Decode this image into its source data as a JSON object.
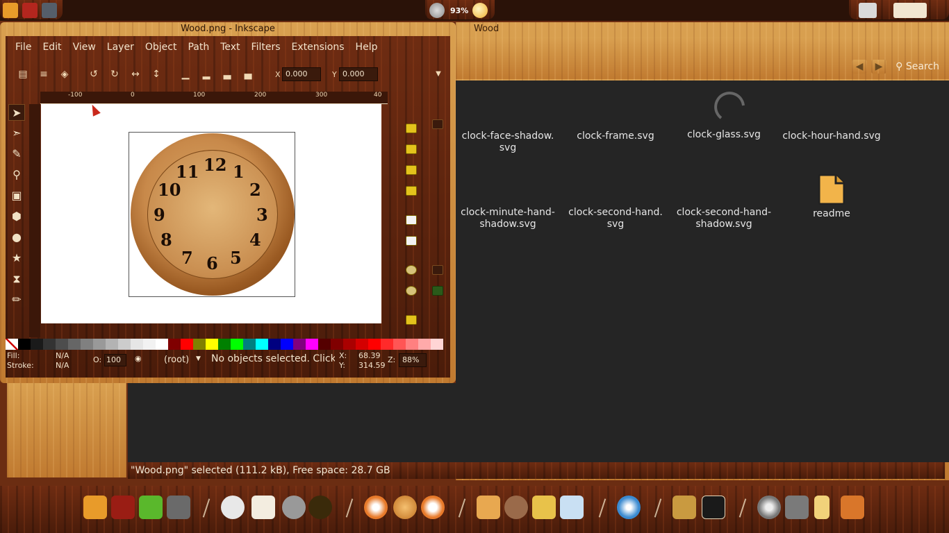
{
  "top_panel": {
    "battery": "93%"
  },
  "inkscape": {
    "title": "Wood.png - Inkscape",
    "menu": [
      "File",
      "Edit",
      "View",
      "Layer",
      "Object",
      "Path",
      "Text",
      "Filters",
      "Extensions",
      "Help"
    ],
    "toolbar": {
      "x_label": "X",
      "x_value": "0.000",
      "y_label": "Y",
      "y_value": "0.000"
    },
    "ruler_ticks": [
      "-100",
      "0",
      "100",
      "200",
      "300",
      "40"
    ],
    "clock_numerals": [
      "12",
      "1",
      "2",
      "3",
      "4",
      "5",
      "6",
      "7",
      "8",
      "9",
      "10",
      "11"
    ],
    "palette": [
      "#000000",
      "#1a1a1a",
      "#333333",
      "#4d4d4d",
      "#666666",
      "#808080",
      "#999999",
      "#b3b3b3",
      "#cccccc",
      "#e6e6e6",
      "#f2f2f2",
      "#ffffff",
      "#800000",
      "#ff0000",
      "#808000",
      "#ffff00",
      "#008000",
      "#00ff00",
      "#008080",
      "#00ffff",
      "#000080",
      "#0000ff",
      "#800080",
      "#ff00ff",
      "#550000",
      "#800000",
      "#aa0000",
      "#d40000",
      "#ff0000",
      "#ff2a2a",
      "#ff5555",
      "#ff8080",
      "#ffaaaa",
      "#ffd5d5"
    ],
    "status": {
      "fill_label": "Fill:",
      "fill_value": "N/A",
      "stroke_label": "Stroke:",
      "stroke_value": "N/A",
      "opacity_label": "O:",
      "opacity_value": "100",
      "layer": "(root)",
      "message": "No objects selected. Click,",
      "x_label": "X:",
      "x_value": "68.39",
      "y_label": "Y:",
      "y_value": "314.59",
      "zoom_label": "Z:",
      "zoom_value": "88%"
    }
  },
  "file_manager": {
    "title": "Wood",
    "search_label": "Search",
    "files": [
      {
        "name": "clock-face-shadow.\nsvg",
        "line1": "clock-face-shadow.",
        "line2": "svg"
      },
      {
        "name": "clock-frame.svg",
        "line1": "clock-frame.svg",
        "line2": ""
      },
      {
        "name": "clock-glass.svg",
        "line1": "clock-glass.svg",
        "line2": ""
      },
      {
        "name": "clock-hour-hand.svg",
        "line1": "clock-hour-hand.svg",
        "line2": ""
      },
      {
        "name": "clock-minute-hand-shadow.svg",
        "line1": "clock-minute-hand-",
        "line2": "shadow.svg"
      },
      {
        "name": "clock-second-hand.svg",
        "line1": "clock-second-hand.",
        "line2": "svg"
      },
      {
        "name": "clock-second-hand-shadow.svg",
        "line1": "clock-second-hand-",
        "line2": "shadow.svg"
      },
      {
        "name": "readme",
        "line1": "readme",
        "line2": ""
      }
    ],
    "status": "\"Wood.png\" selected (111.2 kB), Free space: 28.7 GB"
  },
  "colors": {
    "accent_wood": "#c98a3d",
    "dark_wood": "#5a2410",
    "content_bg": "#252525"
  }
}
